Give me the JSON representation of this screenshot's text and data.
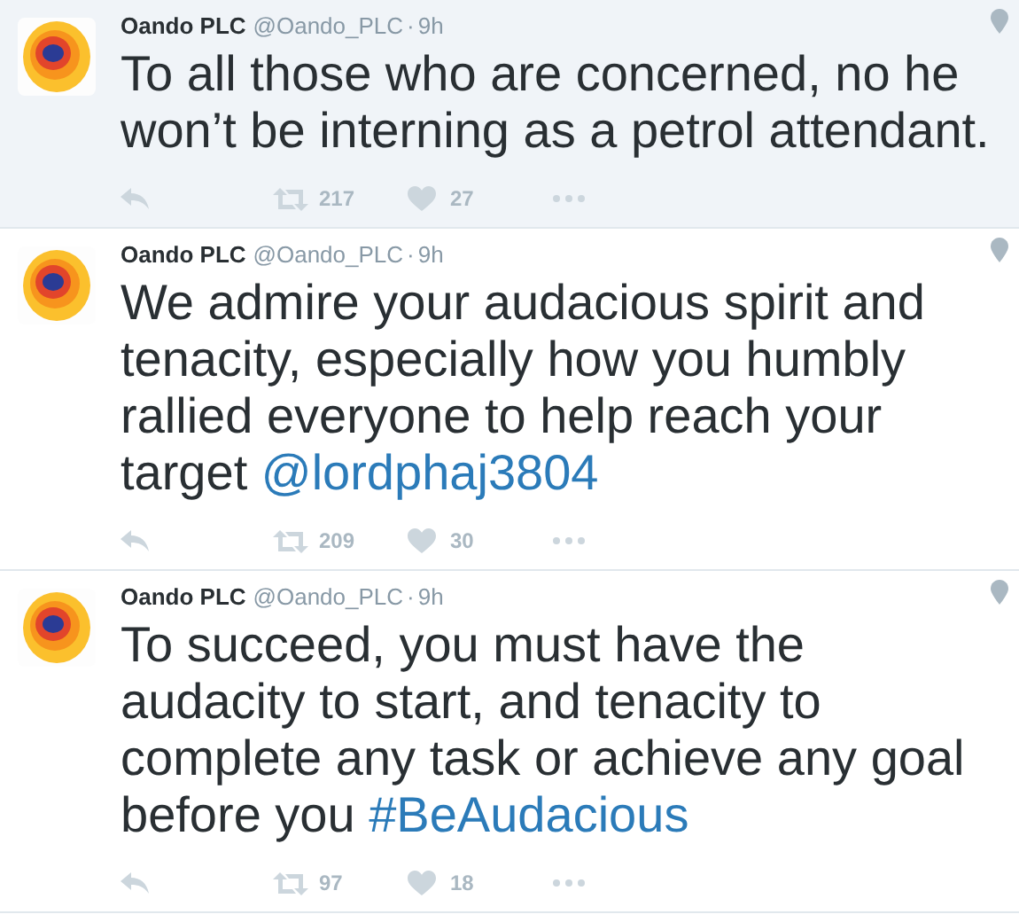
{
  "tweets": [
    {
      "name": "Oando PLC",
      "handle": "@Oando_PLC",
      "separator": "·",
      "time": "9h",
      "text": "To all those who are concerned, no he won’t be interning as a petrol attendant.",
      "retweets": "217",
      "likes": "27",
      "highlighted": true
    },
    {
      "name": "Oando PLC",
      "handle": "@Oando_PLC",
      "separator": "·",
      "time": "9h",
      "text": "We admire your audacious spirit and tenacity, especially how you humbly rallied everyone to help reach your target",
      "link": "@lordphaj3804",
      "retweets": "209",
      "likes": "30",
      "highlighted": false
    },
    {
      "name": "Oando PLC",
      "handle": "@Oando_PLC",
      "separator": "·",
      "time": "9h",
      "text": "To succeed, you must have the audacity to start, and tenacity to complete any task or achieve any goal before you",
      "link": "#BeAudacious",
      "retweets": "97",
      "likes": "18",
      "highlighted": false
    }
  ]
}
